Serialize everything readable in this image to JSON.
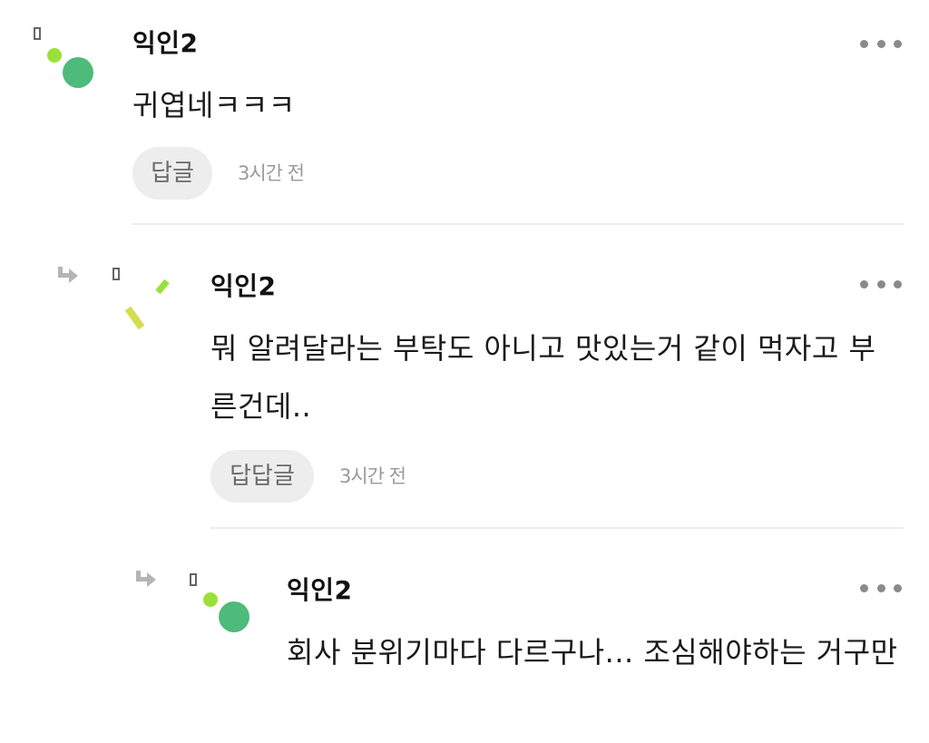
{
  "comments": [
    {
      "username": "익인2",
      "text": "귀엽네ㅋㅋㅋ",
      "reply_label": "답글",
      "time": "3시간 전",
      "avatar_icon": "dots-avatar-icon"
    },
    {
      "username": "익인2",
      "text": "뭐 알려달라는 부탁도 아니고 맛있는거 같이 먹자고 부른건데..",
      "reply_label": "답답글",
      "time": "3시간 전",
      "avatar_icon": "dashes-avatar-icon",
      "reply_icon": "reply-arrow-icon"
    },
    {
      "username": "익인2",
      "text": "회사 분위기마다 다르구나... 조심해야하는 거구만",
      "avatar_icon": "dots-avatar-icon",
      "reply_icon": "reply-arrow-icon"
    }
  ],
  "colors": {
    "avatar_green": "#4dbb7a",
    "avatar_lime": "#9be03a",
    "avatar_yellow": "#d6dd4c",
    "icon_gray": "#b5b5b5"
  }
}
